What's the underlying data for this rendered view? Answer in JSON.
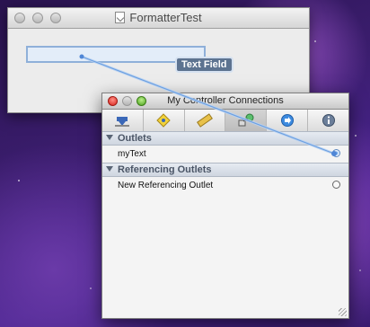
{
  "formatter_window": {
    "title": "FormatterTest",
    "text_field_label": "Text Field"
  },
  "connections_panel": {
    "title": "My Controller Connections",
    "toolbar": {
      "items": [
        "attributes-icon",
        "bindings-icon",
        "size-icon",
        "connections-icon",
        "effects-icon",
        "info-icon"
      ],
      "selected": 3
    },
    "outlets": {
      "header": "Outlets",
      "items": [
        {
          "label": "myText",
          "connected": true
        }
      ]
    },
    "referencing_outlets": {
      "header": "Referencing Outlets",
      "items": [
        {
          "label": "New Referencing Outlet",
          "connected": false
        }
      ]
    }
  },
  "colors": {
    "connection_line": "#8fb6e8",
    "tag_background": "#5d7390",
    "close_button": "#d8241d",
    "zoom_button": "#4da31f"
  }
}
